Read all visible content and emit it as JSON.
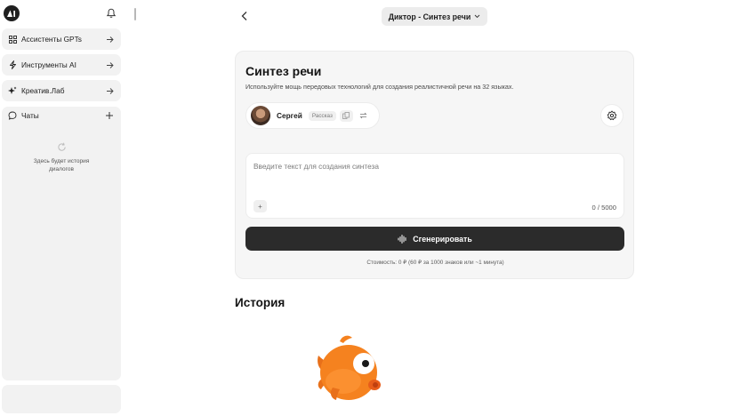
{
  "sidebar": {
    "items": [
      {
        "label": "Ассистенты GPTs",
        "icon": "grid-icon"
      },
      {
        "label": "Инструменты AI",
        "icon": "lightning-icon"
      },
      {
        "label": "Креатив.Лаб",
        "icon": "sparkle-icon"
      }
    ],
    "chats": {
      "label": "Чаты",
      "empty_text": "Здесь будет история диалогов"
    }
  },
  "header": {
    "model_selector": "Диктор - Синтез речи"
  },
  "main": {
    "title": "Синтез речи",
    "subtitle": "Используйте мощь передовых технологий для создания реалистичной речи на 32 языках.",
    "voice": {
      "name": "Сергей",
      "tag": "Рассказ"
    },
    "input": {
      "placeholder": "Введите текст для создания синтеза",
      "add_label": "+",
      "counter": "0 / 5000"
    },
    "generate_label": "Сгенерировать",
    "cost_text": "Стоимость: 0 ₽ (60 ₽ за 1000 знаков или ~1 минута)"
  },
  "history": {
    "title": "История"
  },
  "colors": {
    "accent_dark": "#2b2b2b",
    "panel": "#f2f2f2",
    "mascot_orange": "#f5821f"
  }
}
